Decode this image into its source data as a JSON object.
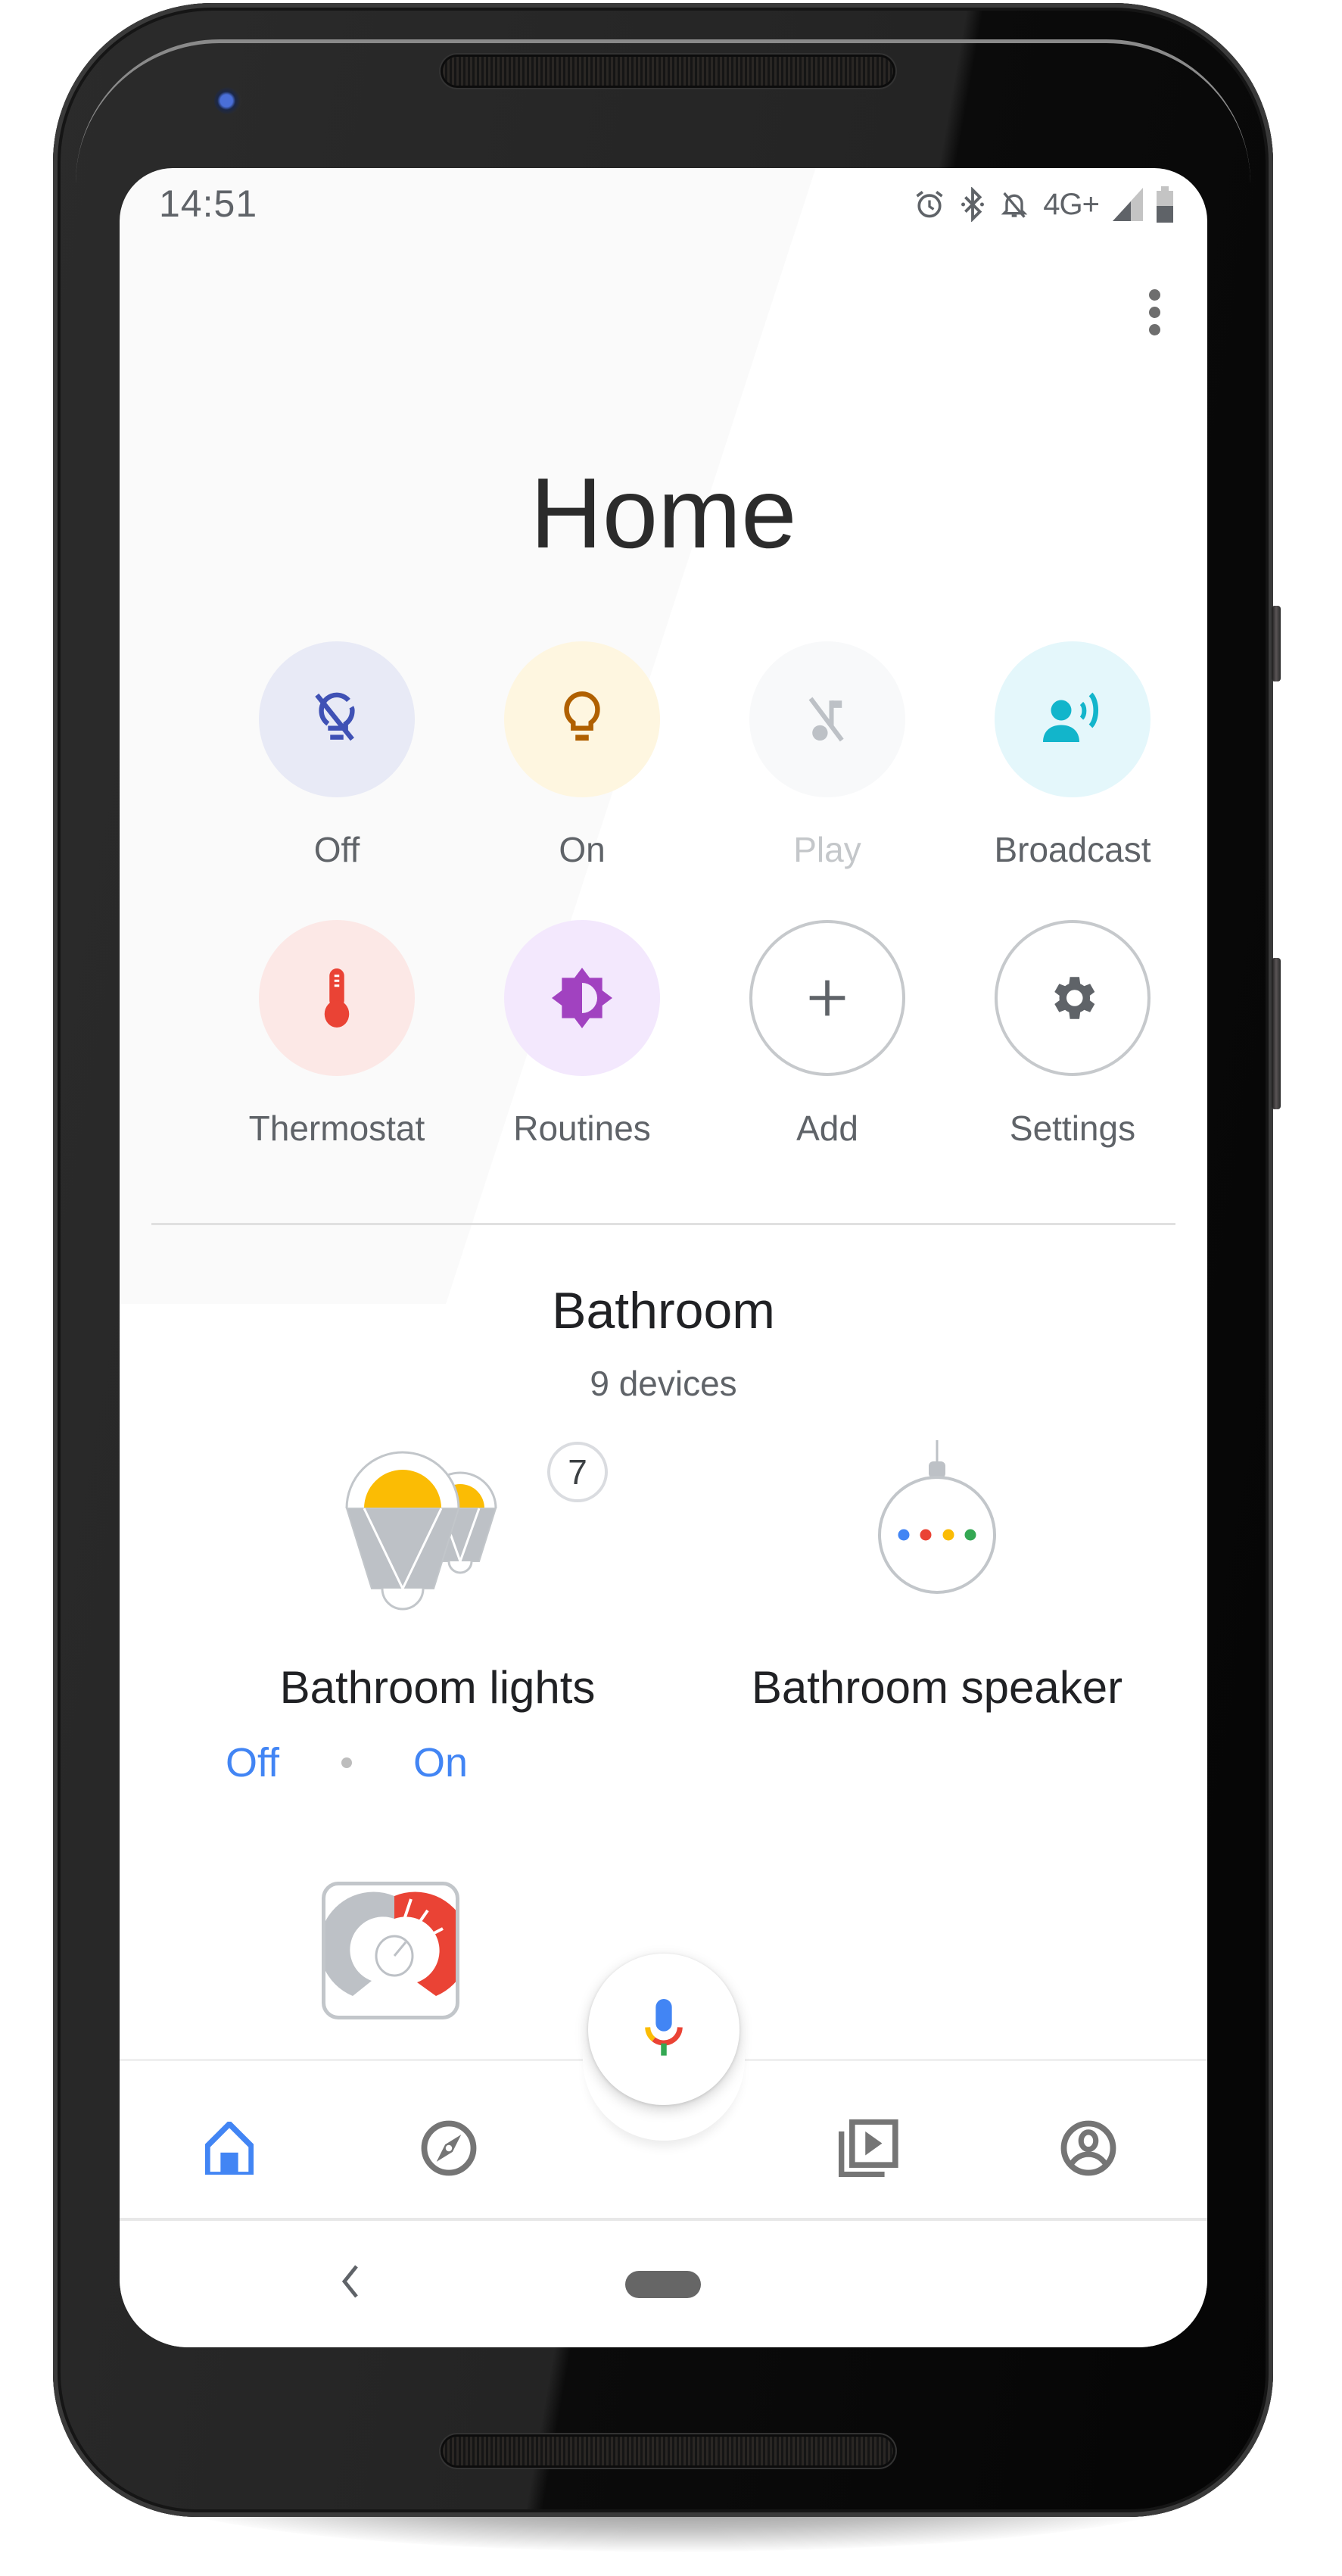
{
  "status_bar": {
    "time": "14:51",
    "network": "4G+",
    "icons": [
      "alarm-icon",
      "bluetooth-icon",
      "notifications-off-icon",
      "network-4g-icon",
      "signal-icon",
      "battery-icon"
    ]
  },
  "header": {
    "title": "Home",
    "overflow_icon": "more-vert-icon"
  },
  "quick_actions": [
    {
      "label": "Off",
      "icon": "lightbulb-off-icon",
      "bg": "#e8eaf6",
      "fg": "#3f51b5",
      "disabled": false
    },
    {
      "label": "On",
      "icon": "lightbulb-icon",
      "bg": "#fef6e0",
      "fg": "#b06000",
      "disabled": false
    },
    {
      "label": "Play",
      "icon": "music-off-icon",
      "bg": "#f8f9fa",
      "fg": "#bdc1c6",
      "disabled": true
    },
    {
      "label": "Broadcast",
      "icon": "broadcast-icon",
      "bg": "#e4f7fb",
      "fg": "#12b5cb",
      "disabled": false
    },
    {
      "label": "Thermostat",
      "icon": "thermometer-icon",
      "bg": "#fce8e6",
      "fg": "#ea4335",
      "disabled": false
    },
    {
      "label": "Routines",
      "icon": "routines-icon",
      "bg": "#f3e8fd",
      "fg": "#a142c0",
      "disabled": false
    },
    {
      "label": "Add",
      "icon": "add-icon",
      "bg": "#ffffff",
      "fg": "#5f6368",
      "disabled": false
    },
    {
      "label": "Settings",
      "icon": "gear-icon",
      "bg": "#ffffff",
      "fg": "#5f6368",
      "disabled": false
    }
  ],
  "room": {
    "name": "Bathroom",
    "device_count_label": "9 devices",
    "devices": [
      {
        "name": "Bathroom lights",
        "icon": "light-group-icon",
        "group_count": "7",
        "actions": [
          "Off",
          "On"
        ]
      },
      {
        "name": "Bathroom speaker",
        "icon": "smart-speaker-icon"
      },
      {
        "name": "",
        "icon": "thermostat-device-icon"
      }
    ]
  },
  "fab": {
    "icon": "microphone-icon"
  },
  "bottom_nav": {
    "items": [
      {
        "name": "home",
        "icon": "home-icon",
        "active": true
      },
      {
        "name": "discover",
        "icon": "compass-icon",
        "active": false
      },
      {
        "name": "media",
        "icon": "media-library-icon",
        "active": false
      },
      {
        "name": "account",
        "icon": "account-icon",
        "active": false
      }
    ]
  },
  "system_nav": {
    "back_icon": "back-icon",
    "home_pill": "home-pill"
  },
  "colors": {
    "accent_blue": "#4285f4",
    "google_red": "#ea4335",
    "google_yellow": "#fbbc04",
    "google_green": "#34a853",
    "icon_gray": "#5f6368",
    "device_gray": "#bdc1c6"
  }
}
